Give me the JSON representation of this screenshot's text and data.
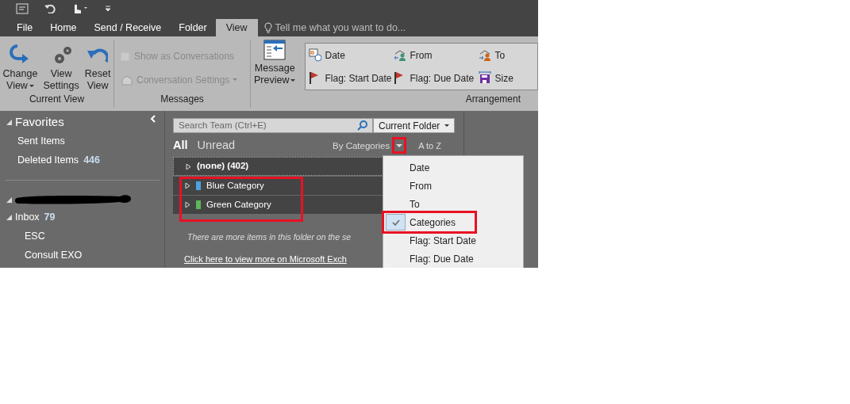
{
  "ribbon_tabs": [
    {
      "label": "File",
      "selected": false
    },
    {
      "label": "Home",
      "selected": false
    },
    {
      "label": "Send / Receive",
      "selected": false
    },
    {
      "label": "Folder",
      "selected": false
    },
    {
      "label": "View",
      "selected": true
    }
  ],
  "tell_me": {
    "placeholder": "Tell me what you want to do..."
  },
  "ribbon_groups": [
    {
      "label": "Current View",
      "buttons": [
        {
          "kind": "change",
          "line1": "Change",
          "line2": "View",
          "dropdown": true
        },
        {
          "kind": "settings",
          "line1": "View",
          "line2": "Settings",
          "dropdown": false
        },
        {
          "kind": "reset",
          "line1": "Reset",
          "line2": "View",
          "dropdown": false
        }
      ]
    },
    {
      "label": "Messages",
      "show_conversations": {
        "label": "Show as Conversations",
        "checked": false,
        "disabled": true
      },
      "conversation_settings": {
        "label": "Conversation Settings",
        "disabled": true
      }
    },
    {
      "label": "Arrangement",
      "preview": {
        "line1": "Message",
        "line2": "Preview"
      },
      "items": [
        {
          "kind": "date",
          "label": "Date"
        },
        {
          "kind": "from",
          "label": "From"
        },
        {
          "kind": "to",
          "label": "To"
        },
        {
          "kind": "flag",
          "label": "Flag: Start Date"
        },
        {
          "kind": "flag",
          "label": "Flag: Due Date"
        },
        {
          "kind": "size",
          "label": "Size"
        }
      ]
    }
  ],
  "favorites": {
    "title": "Favorites",
    "expanded": true,
    "items": [
      {
        "label": "Sent Items"
      },
      {
        "label": "Deleted Items",
        "count": "446"
      }
    ]
  },
  "account": {
    "expanded": true,
    "folders": [
      {
        "label": "Inbox",
        "count": "79",
        "expanded": true,
        "children": [
          {
            "label": "ESC"
          },
          {
            "label": "Consult EXO"
          }
        ]
      }
    ]
  },
  "search": {
    "placeholder": "Search Team (Ctrl+E)",
    "scope": "Current Folder"
  },
  "filters": [
    {
      "label": "All",
      "selected": true
    },
    {
      "label": "Unread",
      "selected": false
    }
  ],
  "sort": {
    "label": "By Categories",
    "order": "A to Z",
    "highlighted": true
  },
  "groups": [
    {
      "label": "(none) (402)",
      "highlighted": false
    },
    {
      "label": "Blue Category",
      "color": "#4aa3df",
      "highlighted": true
    },
    {
      "label": "Green Category",
      "color": "#5cb85c",
      "highlighted": true
    }
  ],
  "notice": "There are more items in this folder on the se",
  "exchange_link": "Click here to view more on Microsoft Exch",
  "arrange_menu": [
    {
      "label": "Date",
      "checked": false,
      "highlighted": false
    },
    {
      "label": "From",
      "checked": false,
      "highlighted": false
    },
    {
      "label": "To",
      "checked": false,
      "highlighted": false
    },
    {
      "label": "Categories",
      "checked": true,
      "highlighted": true
    },
    {
      "label": "Flag: Start Date",
      "checked": false,
      "highlighted": false
    },
    {
      "label": "Flag: Due Date",
      "checked": false,
      "highlighted": false
    }
  ]
}
